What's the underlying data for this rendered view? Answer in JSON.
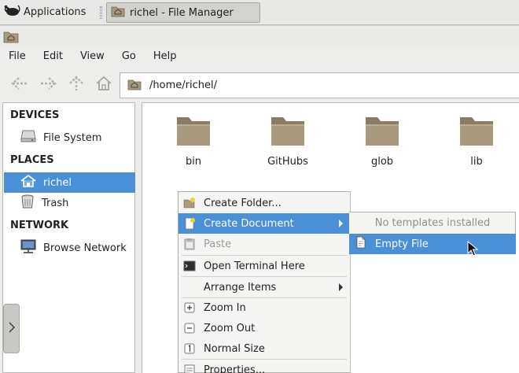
{
  "taskbar": {
    "apps_label": "Applications",
    "task_label": "richel - File Manager"
  },
  "menubar": [
    "File",
    "Edit",
    "View",
    "Go",
    "Help"
  ],
  "toolbar": {
    "path": "/home/richel/"
  },
  "sidebar": {
    "sections": {
      "devices": "DEVICES",
      "places": "PLACES",
      "network": "NETWORK"
    },
    "items": {
      "file_system": "File System",
      "home": "richel",
      "trash": "Trash",
      "browse_network": "Browse Network"
    }
  },
  "folders": [
    "bin",
    "GitHubs",
    "glob",
    "lib"
  ],
  "context_menu": {
    "create_folder": "Create Folder...",
    "create_document": "Create Document",
    "paste": "Paste",
    "open_terminal": "Open Terminal Here",
    "arrange_items": "Arrange Items",
    "zoom_in": "Zoom In",
    "zoom_out": "Zoom Out",
    "normal_size": "Normal Size",
    "properties": "Properties..."
  },
  "submenu": {
    "no_templates": "No templates installed",
    "empty_file": "Empty File"
  },
  "colors": {
    "selection": "#4a90d9",
    "folder": "#9b8b73"
  }
}
